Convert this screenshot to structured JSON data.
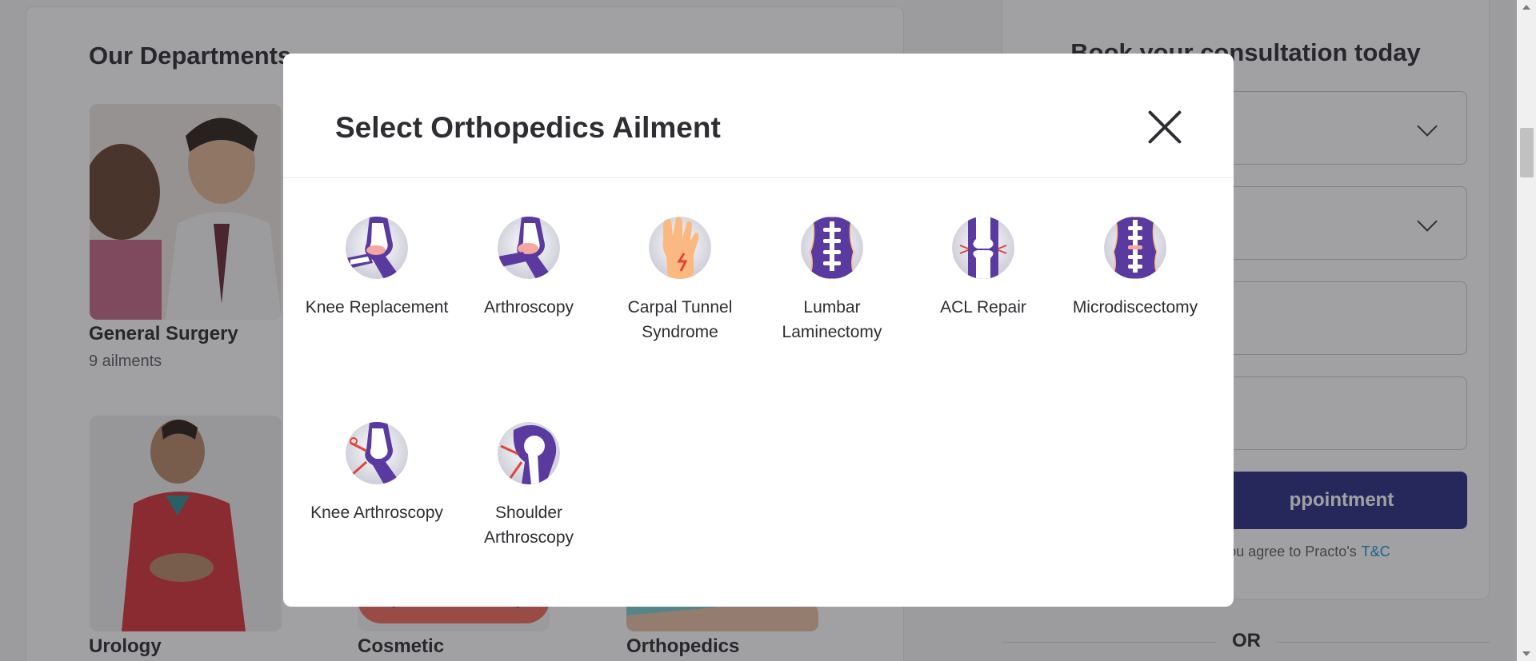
{
  "background": {
    "departments_title": "Our Departments",
    "departments": [
      {
        "name": "General Surgery",
        "sub": "9 ailments"
      },
      {
        "name": "Urology",
        "sub": ""
      },
      {
        "name": "Cosmetic",
        "sub": ""
      },
      {
        "name": "Orthopedics",
        "sub": ""
      }
    ],
    "booking": {
      "title": "Book your consultation today",
      "button_label": "ppointment",
      "terms_text": ", you agree to Practo's",
      "terms_link": "T&C",
      "or_label": "OR"
    }
  },
  "modal": {
    "title": "Select Orthopedics Ailment",
    "close_icon": "close-icon",
    "ailments": [
      {
        "label": "Knee Replacement",
        "icon": "knee-replacement-icon"
      },
      {
        "label": "Arthroscopy",
        "icon": "arthroscopy-icon"
      },
      {
        "label": "Carpal Tunnel Syndrome",
        "icon": "carpal-tunnel-icon"
      },
      {
        "label": "Lumbar Laminectomy",
        "icon": "lumbar-laminectomy-icon"
      },
      {
        "label": "ACL Repair",
        "icon": "acl-repair-icon"
      },
      {
        "label": "Microdiscectomy",
        "icon": "microdiscectomy-icon"
      },
      {
        "label": "Knee Arthroscopy",
        "icon": "knee-arthroscopy-icon"
      },
      {
        "label": "Shoulder Arthroscopy",
        "icon": "shoulder-arthroscopy-icon"
      }
    ]
  },
  "colors": {
    "accent_purple": "#5b3aa0",
    "brand_button": "#2b2f84",
    "link": "#1f8fd6",
    "bone_pink": "#f4a6a0",
    "skin": "#f9b980"
  }
}
